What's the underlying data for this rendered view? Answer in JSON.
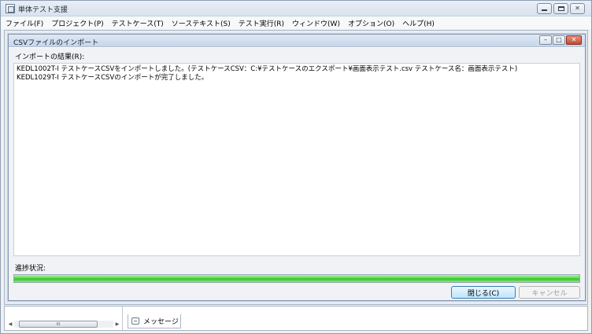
{
  "app": {
    "title": "単体テスト支援"
  },
  "menubar": {
    "items": [
      "ファイル(F)",
      "プロジェクト(P)",
      "テストケース(T)",
      "ソーステキスト(S)",
      "テスト実行(R)",
      "ウィンドウ(W)",
      "オプション(O)",
      "ヘルプ(H)"
    ]
  },
  "dialog": {
    "title": "CSVファイルのインポート",
    "results_label": "インポートの結果(R):",
    "results": [
      "KEDL1002T-I テストケースCSVをインポートしました。(テストケースCSV：C:¥テストケースのエクスポート¥画面表示テスト.csv テストケース名：画面表示テスト)",
      "KEDL1029T-I テストケースCSVのインポートが完了しました。"
    ],
    "progress_label": "進捗状況:",
    "progress": 1.0,
    "close_button": "閉じる(C)",
    "cancel_button": "キャンセル"
  },
  "bottom": {
    "tab_message": "メッセージ",
    "scroll_grip": "III"
  },
  "colors": {
    "progress_fill": "#46d63a",
    "close_button_border": "#3c7fb1"
  }
}
